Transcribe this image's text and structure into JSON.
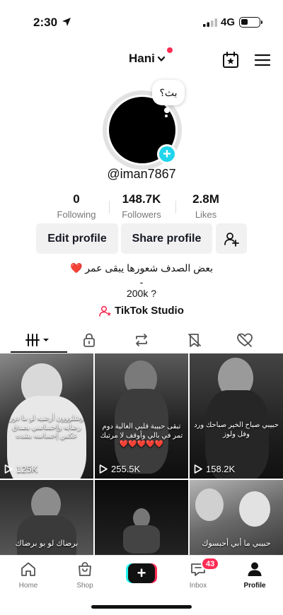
{
  "status_bar": {
    "time": "2:30",
    "network": "4G"
  },
  "header": {
    "username": "Hani"
  },
  "profile": {
    "bubble_text": "بث؟",
    "handle": "@iman7867",
    "stats": [
      {
        "value": "0",
        "label": "Following"
      },
      {
        "value": "148.7K",
        "label": "Followers"
      },
      {
        "value": "2.8M",
        "label": "Likes"
      }
    ],
    "buttons": {
      "edit": "Edit profile",
      "share": "Share profile"
    },
    "bio": [
      "بعض الصدف شعورها يبقى عمر ❤️",
      "-",
      "200k ?"
    ],
    "studio_label": "TikTok Studio"
  },
  "videos": [
    {
      "views": "125K",
      "caption": "وشلووون أرضيه لو ما دور رضايه وإحساسي بصدق عكس إحساسه بشده"
    },
    {
      "views": "255.5K",
      "caption": "تبقى حبيبة قلبي الغالية دوم تمر في بالي وأوقف لا مرتبك ❤️❤️❤️❤️❤️"
    },
    {
      "views": "158.2K",
      "caption": "حبيبي صباح الخير صباحك ورد وفل ولوز"
    },
    {
      "views": "",
      "caption": "برضاك لو بو برضاك"
    },
    {
      "views": "",
      "caption": ""
    },
    {
      "views": "",
      "caption": "حبيبي ما أبي أحبسوك"
    }
  ],
  "bottom_nav": {
    "items": [
      "Home",
      "Shop",
      "Inbox",
      "Profile"
    ],
    "inbox_badge": "43"
  },
  "colors": {
    "accent": "#fe2c55",
    "cyan": "#25f4ee",
    "plus": "#20d5ec"
  }
}
